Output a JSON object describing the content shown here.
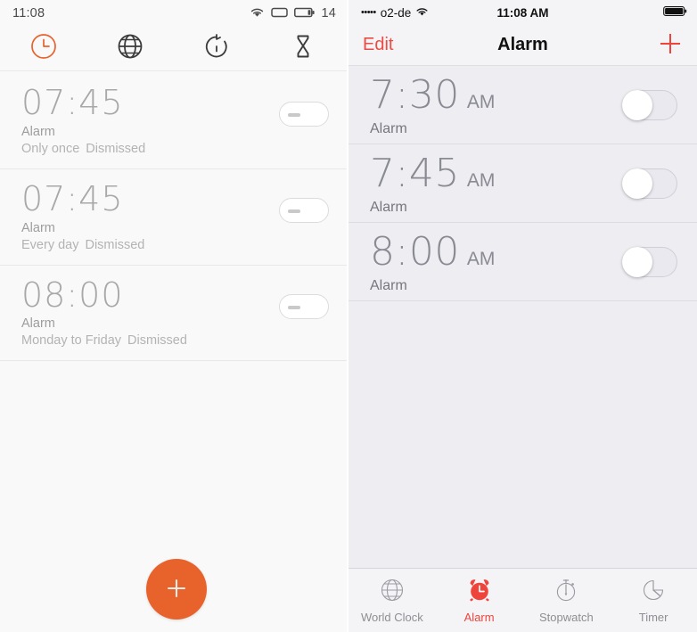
{
  "android": {
    "status_bar": {
      "time": "11:08",
      "battery_percent": "14",
      "icons": [
        "wifi-icon",
        "signal-icon",
        "battery-icon"
      ]
    },
    "tabs": [
      {
        "name": "tab-clock",
        "icon": "clock-icon",
        "active": true
      },
      {
        "name": "tab-world-clock",
        "icon": "globe-icon",
        "active": false
      },
      {
        "name": "tab-stopwatch",
        "icon": "stopwatch-icon",
        "active": false
      },
      {
        "name": "tab-timer",
        "icon": "hourglass-icon",
        "active": false
      }
    ],
    "alarms": [
      {
        "time": "07:45",
        "label": "Alarm",
        "repeat": "Only once",
        "state": "Dismissed",
        "enabled": false
      },
      {
        "time": "07:45",
        "label": "Alarm",
        "repeat": "Every day",
        "state": "Dismissed",
        "enabled": false
      },
      {
        "time": "08:00",
        "label": "Alarm",
        "repeat": "Monday to Friday",
        "state": "Dismissed",
        "enabled": false
      }
    ],
    "fab": {
      "label": "+",
      "icon": "plus-icon"
    },
    "colors": {
      "accent": "#e8622c",
      "background": "#f9f9f9",
      "text_muted": "#a8a8a8"
    }
  },
  "ios": {
    "status_bar": {
      "signal_dots": "•••••",
      "carrier": "o2-de",
      "time": "11:08 AM",
      "icons": [
        "wifi-icon",
        "battery-icon"
      ]
    },
    "nav": {
      "edit_label": "Edit",
      "title": "Alarm",
      "add_label": "+"
    },
    "alarms": [
      {
        "time": "7:30",
        "meridiem": "AM",
        "label": "Alarm",
        "enabled": false
      },
      {
        "time": "7:45",
        "meridiem": "AM",
        "label": "Alarm",
        "enabled": false
      },
      {
        "time": "8:00",
        "meridiem": "AM",
        "label": "Alarm",
        "enabled": false
      }
    ],
    "tabs": [
      {
        "label": "World Clock",
        "icon": "globe-icon",
        "active": false
      },
      {
        "label": "Alarm",
        "icon": "alarm-clock-icon",
        "active": true
      },
      {
        "label": "Stopwatch",
        "icon": "stopwatch-icon",
        "active": false
      },
      {
        "label": "Timer",
        "icon": "timer-icon",
        "active": false
      }
    ],
    "colors": {
      "accent": "#ee443c",
      "background": "#ededf2",
      "navbar": "#f4f4f7",
      "text_muted": "#8a8a93"
    }
  }
}
